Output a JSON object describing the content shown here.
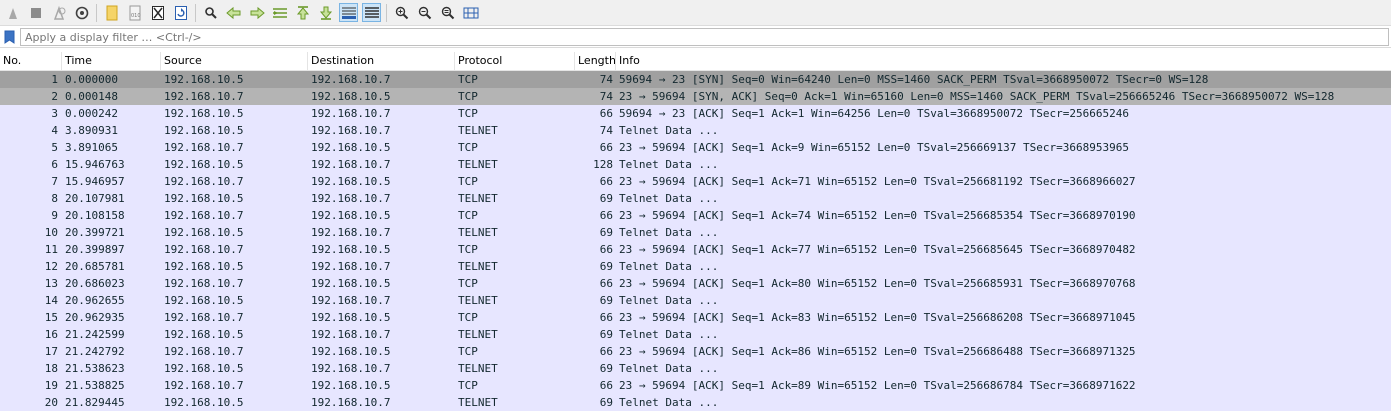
{
  "toolbar": {
    "buttons": [
      {
        "name": "start-capture-icon"
      },
      {
        "name": "stop-capture-icon"
      },
      {
        "name": "restart-capture-icon"
      },
      {
        "name": "capture-options-icon"
      },
      {
        "name": "open-file-icon"
      },
      {
        "name": "save-file-icon"
      },
      {
        "name": "close-file-icon"
      },
      {
        "name": "reload-file-icon"
      },
      {
        "name": "find-packet-icon"
      },
      {
        "name": "go-back-icon"
      },
      {
        "name": "go-forward-icon"
      },
      {
        "name": "go-to-packet-icon"
      },
      {
        "name": "go-first-packet-icon"
      },
      {
        "name": "go-last-packet-icon"
      },
      {
        "name": "auto-scroll-icon"
      },
      {
        "name": "colorize-icon"
      },
      {
        "name": "zoom-in-icon"
      },
      {
        "name": "zoom-out-icon"
      },
      {
        "name": "zoom-normal-icon"
      },
      {
        "name": "resize-columns-icon"
      }
    ]
  },
  "filter": {
    "placeholder": "Apply a display filter … <Ctrl-/>"
  },
  "columns": {
    "no": "No.",
    "time": "Time",
    "source": "Source",
    "destination": "Destination",
    "protocol": "Protocol",
    "length": "Length",
    "info": "Info"
  },
  "packets": [
    {
      "no": "1",
      "time": "0.000000",
      "src": "192.168.10.5",
      "dst": "192.168.10.7",
      "proto": "TCP",
      "len": "74",
      "info": "59694 → 23 [SYN] Seq=0 Win=64240 Len=0 MSS=1460 SACK_PERM TSval=3668950072 TSecr=0 WS=128"
    },
    {
      "no": "2",
      "time": "0.000148",
      "src": "192.168.10.7",
      "dst": "192.168.10.5",
      "proto": "TCP",
      "len": "74",
      "info": "23 → 59694 [SYN, ACK] Seq=0 Ack=1 Win=65160 Len=0 MSS=1460 SACK_PERM TSval=256665246 TSecr=3668950072 WS=128"
    },
    {
      "no": "3",
      "time": "0.000242",
      "src": "192.168.10.5",
      "dst": "192.168.10.7",
      "proto": "TCP",
      "len": "66",
      "info": "59694 → 23 [ACK] Seq=1 Ack=1 Win=64256 Len=0 TSval=3668950072 TSecr=256665246"
    },
    {
      "no": "4",
      "time": "3.890931",
      "src": "192.168.10.5",
      "dst": "192.168.10.7",
      "proto": "TELNET",
      "len": "74",
      "info": "Telnet Data ..."
    },
    {
      "no": "5",
      "time": "3.891065",
      "src": "192.168.10.7",
      "dst": "192.168.10.5",
      "proto": "TCP",
      "len": "66",
      "info": "23 → 59694 [ACK] Seq=1 Ack=9 Win=65152 Len=0 TSval=256669137 TSecr=3668953965"
    },
    {
      "no": "6",
      "time": "15.946763",
      "src": "192.168.10.5",
      "dst": "192.168.10.7",
      "proto": "TELNET",
      "len": "128",
      "info": "Telnet Data ..."
    },
    {
      "no": "7",
      "time": "15.946957",
      "src": "192.168.10.7",
      "dst": "192.168.10.5",
      "proto": "TCP",
      "len": "66",
      "info": "23 → 59694 [ACK] Seq=1 Ack=71 Win=65152 Len=0 TSval=256681192 TSecr=3668966027"
    },
    {
      "no": "8",
      "time": "20.107981",
      "src": "192.168.10.5",
      "dst": "192.168.10.7",
      "proto": "TELNET",
      "len": "69",
      "info": "Telnet Data ..."
    },
    {
      "no": "9",
      "time": "20.108158",
      "src": "192.168.10.7",
      "dst": "192.168.10.5",
      "proto": "TCP",
      "len": "66",
      "info": "23 → 59694 [ACK] Seq=1 Ack=74 Win=65152 Len=0 TSval=256685354 TSecr=3668970190"
    },
    {
      "no": "10",
      "time": "20.399721",
      "src": "192.168.10.5",
      "dst": "192.168.10.7",
      "proto": "TELNET",
      "len": "69",
      "info": "Telnet Data ..."
    },
    {
      "no": "11",
      "time": "20.399897",
      "src": "192.168.10.7",
      "dst": "192.168.10.5",
      "proto": "TCP",
      "len": "66",
      "info": "23 → 59694 [ACK] Seq=1 Ack=77 Win=65152 Len=0 TSval=256685645 TSecr=3668970482"
    },
    {
      "no": "12",
      "time": "20.685781",
      "src": "192.168.10.5",
      "dst": "192.168.10.7",
      "proto": "TELNET",
      "len": "69",
      "info": "Telnet Data ..."
    },
    {
      "no": "13",
      "time": "20.686023",
      "src": "192.168.10.7",
      "dst": "192.168.10.5",
      "proto": "TCP",
      "len": "66",
      "info": "23 → 59694 [ACK] Seq=1 Ack=80 Win=65152 Len=0 TSval=256685931 TSecr=3668970768"
    },
    {
      "no": "14",
      "time": "20.962655",
      "src": "192.168.10.5",
      "dst": "192.168.10.7",
      "proto": "TELNET",
      "len": "69",
      "info": "Telnet Data ..."
    },
    {
      "no": "15",
      "time": "20.962935",
      "src": "192.168.10.7",
      "dst": "192.168.10.5",
      "proto": "TCP",
      "len": "66",
      "info": "23 → 59694 [ACK] Seq=1 Ack=83 Win=65152 Len=0 TSval=256686208 TSecr=3668971045"
    },
    {
      "no": "16",
      "time": "21.242599",
      "src": "192.168.10.5",
      "dst": "192.168.10.7",
      "proto": "TELNET",
      "len": "69",
      "info": "Telnet Data ..."
    },
    {
      "no": "17",
      "time": "21.242792",
      "src": "192.168.10.7",
      "dst": "192.168.10.5",
      "proto": "TCP",
      "len": "66",
      "info": "23 → 59694 [ACK] Seq=1 Ack=86 Win=65152 Len=0 TSval=256686488 TSecr=3668971325"
    },
    {
      "no": "18",
      "time": "21.538623",
      "src": "192.168.10.5",
      "dst": "192.168.10.7",
      "proto": "TELNET",
      "len": "69",
      "info": "Telnet Data ..."
    },
    {
      "no": "19",
      "time": "21.538825",
      "src": "192.168.10.7",
      "dst": "192.168.10.5",
      "proto": "TCP",
      "len": "66",
      "info": "23 → 59694 [ACK] Seq=1 Ack=89 Win=65152 Len=0 TSval=256686784 TSecr=3668971622"
    },
    {
      "no": "20",
      "time": "21.829445",
      "src": "192.168.10.5",
      "dst": "192.168.10.7",
      "proto": "TELNET",
      "len": "69",
      "info": "Telnet Data ..."
    }
  ],
  "colors": {
    "row_tcp_telnet": "#e7e6ff",
    "row_syn": "#a0a0a0",
    "row_syn_ack": "#b4b4b4",
    "row_text": "#12272e"
  }
}
